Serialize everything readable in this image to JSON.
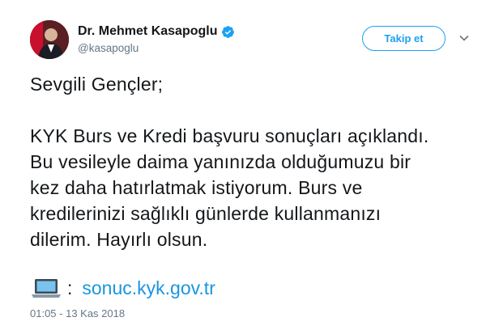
{
  "author": {
    "name": "Dr. Mehmet Kasapoglu",
    "handle": "@kasapoglu"
  },
  "follow_label": "Takip et",
  "tweet": {
    "greeting": "Sevgili Gençler;",
    "lines": [
      "KYK Burs ve Kredi başvuru sonuçları açıklandı.",
      "Bu vesileyle daima yanınızda olduğumuzu bir",
      "kez daha hatırlatmak istiyorum. Burs ve",
      "kredilerinizi sağlıklı günlerde kullanmanızı",
      "dilerim. Hayırlı olsun."
    ],
    "link_prefix": ":",
    "link_text": "sonuc.kyk.gov.tr"
  },
  "timestamp": "01:05 - 13 Kas 2018",
  "colors": {
    "accent": "#1da1f2",
    "link": "#1b95e0",
    "muted": "#657786",
    "text": "#14171a"
  },
  "icons": [
    "avatar",
    "verified-badge-icon",
    "chevron-down-icon",
    "laptop-emoji-icon"
  ]
}
